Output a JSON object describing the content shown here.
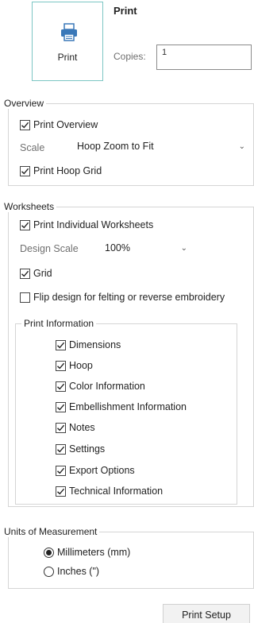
{
  "print_tile": {
    "label": "Print",
    "icon": "printer-icon"
  },
  "header": {
    "title": "Print"
  },
  "copies": {
    "label": "Copies:",
    "value": "1"
  },
  "overview": {
    "legend": "Overview",
    "print_overview": {
      "label": "Print Overview",
      "checked": true
    },
    "scale": {
      "label": "Scale",
      "value": "Hoop Zoom to Fit"
    },
    "print_hoop_grid": {
      "label": "Print Hoop Grid",
      "checked": true
    }
  },
  "worksheets": {
    "legend": "Worksheets",
    "print_individual": {
      "label": "Print Individual Worksheets",
      "checked": true
    },
    "design_scale": {
      "label": "Design Scale",
      "value": "100%"
    },
    "grid": {
      "label": "Grid",
      "checked": true
    },
    "flip": {
      "label": "Flip design for felting or reverse embroidery",
      "checked": false
    },
    "print_information": {
      "legend": "Print Information",
      "items": [
        {
          "label": "Dimensions",
          "checked": true
        },
        {
          "label": "Hoop",
          "checked": true
        },
        {
          "label": "Color Information",
          "checked": true
        },
        {
          "label": "Embellishment Information",
          "checked": true
        },
        {
          "label": "Notes",
          "checked": true
        },
        {
          "label": "Settings",
          "checked": true
        },
        {
          "label": "Export Options",
          "checked": true
        },
        {
          "label": "Technical Information",
          "checked": true
        }
      ]
    }
  },
  "units": {
    "legend": "Units of Measurement",
    "options": [
      {
        "label": "Millimeters (mm)",
        "selected": true
      },
      {
        "label": "Inches (\")",
        "selected": false
      }
    ]
  },
  "footer": {
    "print_setup": "Print Setup"
  },
  "colors": {
    "tile_border": "#7cc6c4",
    "printer_blue": "#3a78b8"
  }
}
